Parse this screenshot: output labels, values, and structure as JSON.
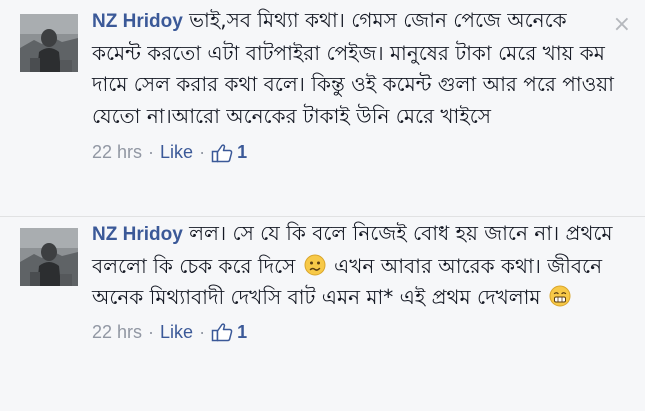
{
  "comments": [
    {
      "author": "NZ Hridoy",
      "text": "ভাই,সব মিথ্যা কথা। গেমস জোন পেজে অনেকে কমেন্ট করতো এটা বাটপাইরা পেইজ। মানুষের টাকা মেরে খায় কম দামে সেল করার কথা বলে। কিন্তু ওই কমেন্ট গুলা আর পরে পাওয়া যেতো না।আরো অনেকের টাকাই উনি মেরে খাইসে",
      "time": "22 hrs",
      "like_label": "Like",
      "like_count": "1",
      "avatar_icon": "user-avatar-icon",
      "close_glyph": "×"
    },
    {
      "author": "NZ Hridoy",
      "text_part1": "লল। সে যে কি বলে নিজেই বোধ হয় জানে না। প্রথমে বললো কি চেক করে দিসে",
      "emoji1": "confused-face-icon",
      "text_part2": "এখন আবার আরেক কথা। জীবনে অনেক মিথ্যাবাদী দেখসি বাট এমন মা* এই প্রথম দেখলাম",
      "emoji2": "grimace-face-icon",
      "time": "22 hrs",
      "like_label": "Like",
      "like_count": "1",
      "avatar_icon": "user-avatar-icon"
    }
  ],
  "colors": {
    "background": "#f6f7f9",
    "author": "#3b5998",
    "meta": "#9197a3",
    "text": "#141823"
  }
}
